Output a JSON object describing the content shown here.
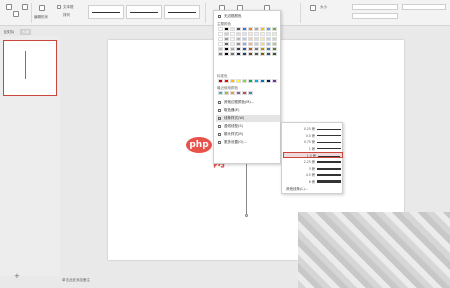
{
  "ribbon": {
    "group_label": "编辑形状",
    "item_a": "文本框",
    "item_b": "排列",
    "fill_label": "填充",
    "outline_label": "轮廓",
    "effect_label": "形状效果",
    "size_label": "大小"
  },
  "tabs": {
    "slides": "幻灯片",
    "outline": "大纲"
  },
  "add_slide": "+",
  "notes": "单击此处添加备注",
  "watermark": {
    "logo": "php",
    "text": "中文网"
  },
  "color_menu": {
    "theme_colors": "主题颜色",
    "standard_colors": "标准色",
    "recent_colors": "最近使用颜色",
    "items": [
      "无边框颜色",
      "其他边框颜色(M)...",
      "取色器(E)",
      "线条样式(W)",
      "虚线线型(S)",
      "箭头样式(R)",
      "更多设置(O)..."
    ]
  },
  "line_width_menu": {
    "widths": [
      "0.25 磅",
      "0.5 磅",
      "0.75 磅",
      "1 磅",
      "1.5 磅",
      "2.25 磅",
      "3 磅",
      "4.5 磅",
      "6 磅"
    ],
    "selected_index": 4,
    "more": "其他线条(L)..."
  },
  "colors": {
    "accent": "#c9463d",
    "theme_row": [
      "#ffffff",
      "#000000",
      "#e7e6e6",
      "#44546a",
      "#4472c4",
      "#ed7d31",
      "#a5a5a5",
      "#ffc000",
      "#5b9bd5",
      "#70ad47"
    ],
    "standard": [
      "#c00000",
      "#ff0000",
      "#ffc000",
      "#ffff00",
      "#92d050",
      "#00b050",
      "#00b0f0",
      "#0070c0",
      "#002060",
      "#7030a0"
    ],
    "recent": [
      "#4bacc6",
      "#9bbb59",
      "#f79646",
      "#8064a2",
      "#c0504d",
      "#4f81bd"
    ]
  }
}
